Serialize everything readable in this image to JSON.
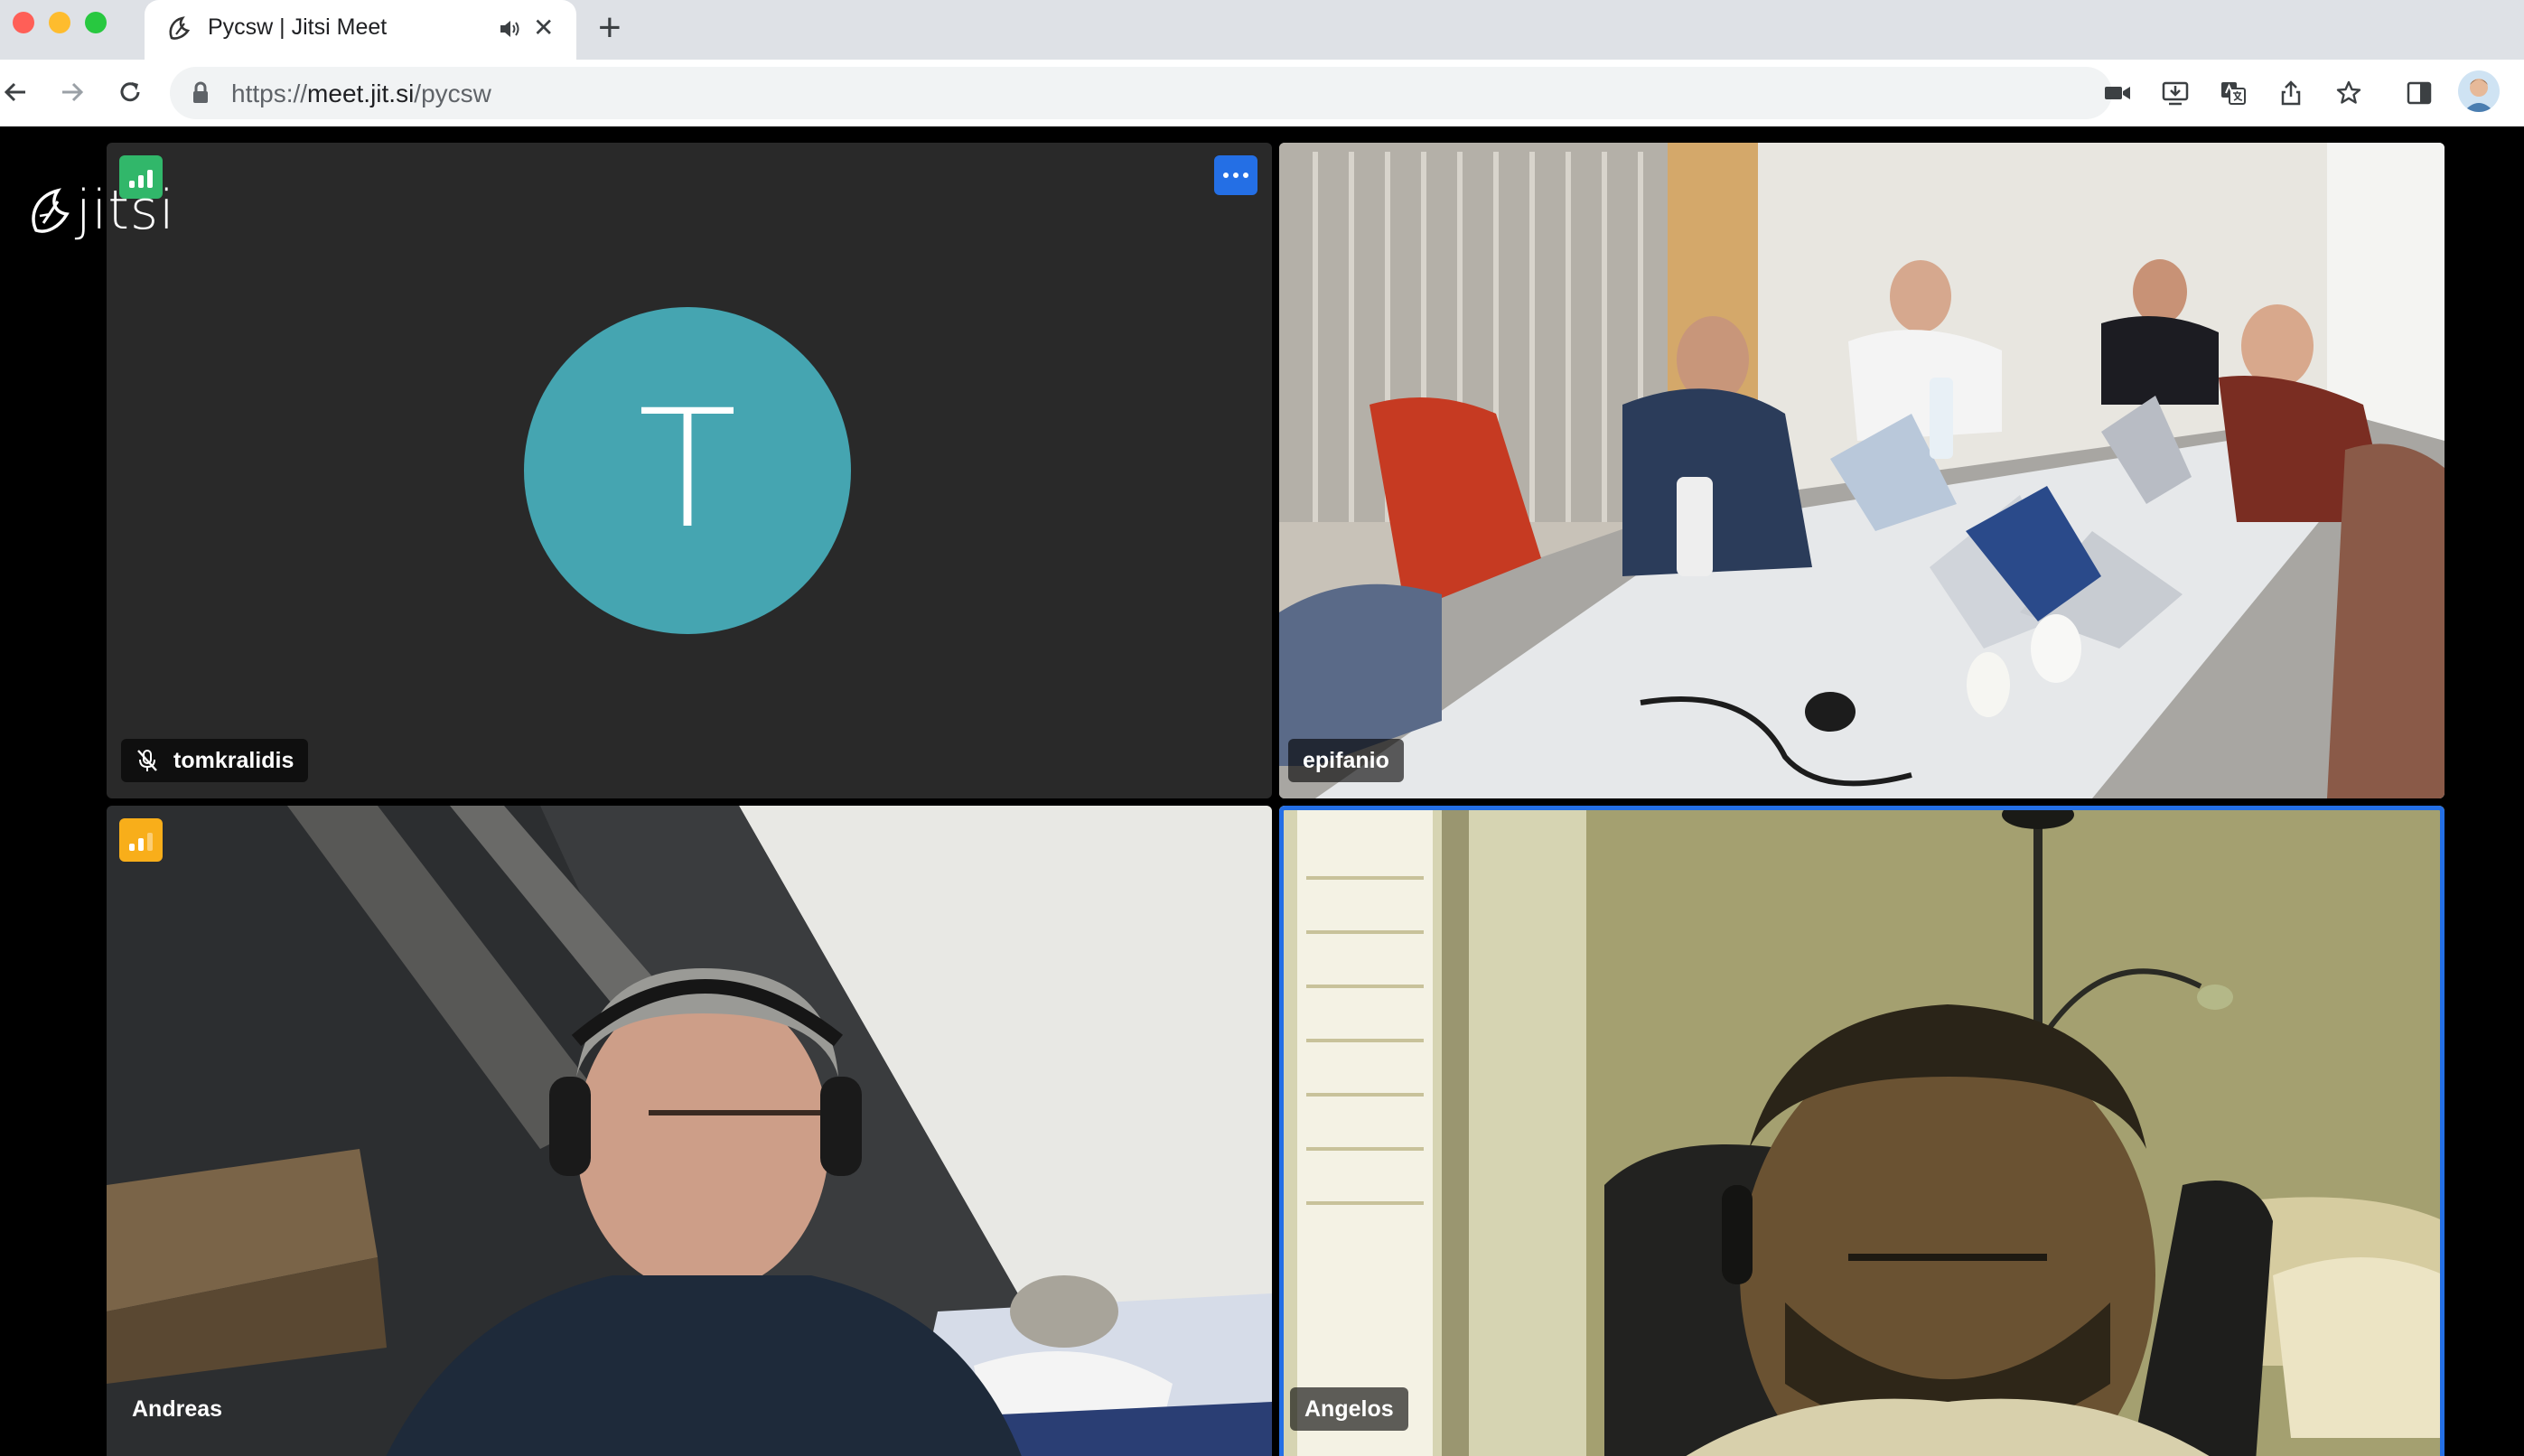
{
  "browser": {
    "tab_title": "Pycsw | Jitsi Meet",
    "url_scheme": "https://",
    "url_host": "meet.jit.si",
    "url_path": "/pycsw",
    "new_tab_symbol": "+",
    "close_symbol": "✕"
  },
  "colors": {
    "avatar_bg": "#45a5b1",
    "active_speaker_border": "#246fe5",
    "more_button_bg": "#246fe5",
    "conn_good": "#31b76a",
    "conn_medium": "#f8ae1a",
    "tile_bg": "#292929"
  },
  "meeting": {
    "logo_text": "jitsi",
    "participants": [
      {
        "name": "tomkralidis",
        "avatar_initial": "T",
        "muted": true,
        "connection": "good",
        "video": false
      },
      {
        "name": "epifanio",
        "video": true
      },
      {
        "name": "Andreas",
        "connection": "medium",
        "video": true
      },
      {
        "name": "Angelos",
        "video": true,
        "active_speaker": true
      }
    ]
  }
}
